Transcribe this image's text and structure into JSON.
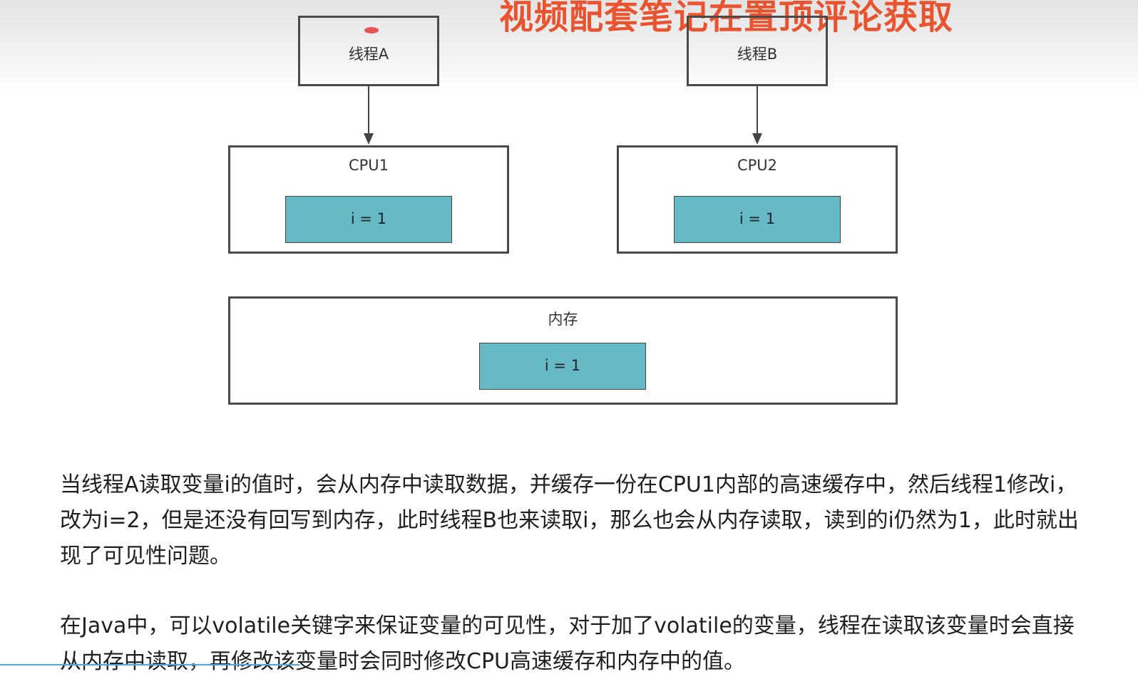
{
  "banner_text": "视频配套笔记在置顶评论获取",
  "diagram": {
    "thread_a": "线程A",
    "thread_b": "线程B",
    "cpu1": {
      "label": "CPU1",
      "cache_value": "i = 1"
    },
    "cpu2": {
      "label": "CPU2",
      "cache_value": "i = 1"
    },
    "memory": {
      "label": "内存",
      "value": "i = 1"
    }
  },
  "paragraphs": [
    "当线程A读取变量i的值时，会从内存中读取数据，并缓存一份在CPU1内部的高速缓存中，然后线程1修改i，改为i=2，但是还没有回写到内存，此时线程B也来读取i，那么也会从内存读取，读到的i仍然为1，此时就出现了可见性问题。",
    "在Java中，可以volatile关键字来保证变量的可见性，对于加了volatile的变量，线程在读取该变量时会直接从内存中读取，再修改该变量时会同时修改CPU高速缓存和内存中的值。"
  ],
  "colors": {
    "cell_fill": "#65bac5",
    "banner": "#e8542f",
    "border": "#4a4a4a"
  }
}
